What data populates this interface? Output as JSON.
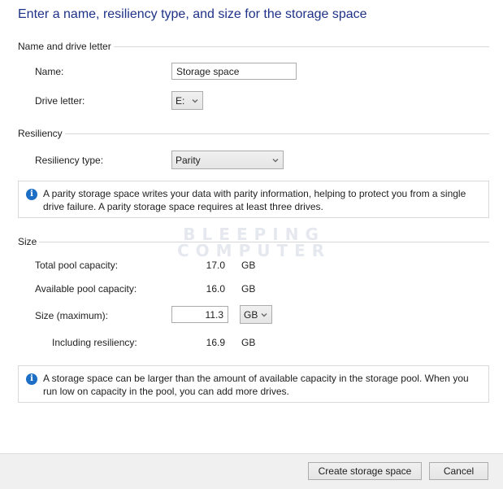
{
  "page": {
    "title": "Enter a name, resiliency type, and size for the storage space"
  },
  "name_section": {
    "header": "Name and drive letter",
    "name_label": "Name:",
    "name_value": "Storage space",
    "drive_letter_label": "Drive letter:",
    "drive_letter_value": "E:"
  },
  "resiliency_section": {
    "header": "Resiliency",
    "type_label": "Resiliency type:",
    "type_value": "Parity",
    "info_text": "A parity storage space writes your data with parity information, helping to protect you from a single drive failure. A parity storage space requires at least three drives."
  },
  "size_section": {
    "header": "Size",
    "total_label": "Total pool capacity:",
    "total_value": "17.0",
    "total_unit": "GB",
    "available_label": "Available pool capacity:",
    "available_value": "16.0",
    "available_unit": "GB",
    "size_label": "Size (maximum):",
    "size_value": "11.3",
    "size_unit_value": "GB",
    "including_label": "Including resiliency:",
    "including_value": "16.9",
    "including_unit": "GB",
    "info_text": "A storage space can be larger than the amount of available capacity in the storage pool. When you run low on capacity in the pool, you can add more drives."
  },
  "footer": {
    "create_label": "Create storage space",
    "cancel_label": "Cancel"
  },
  "watermark": {
    "line1": "BLEEPING",
    "line2": "COMPUTER"
  },
  "icons": {
    "info": "info-icon",
    "dropdown": "chevron-down-icon"
  },
  "colors": {
    "title": "#1e3287",
    "info_icon": "#1d6fc6",
    "footer_bg": "#f0f0f0"
  }
}
